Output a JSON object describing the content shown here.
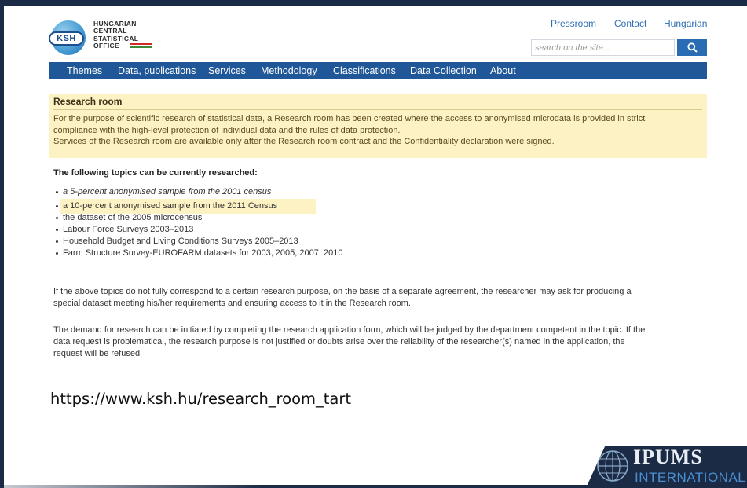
{
  "logo": {
    "abbr": "KSH",
    "line1": "HUNGARIAN",
    "line2": "CENTRAL",
    "line3": "STATISTICAL",
    "line4": "OFFICE"
  },
  "top_links": {
    "pressroom": "Pressroom",
    "contact": "Contact",
    "language": "Hungarian"
  },
  "search": {
    "placeholder": "search on the site..."
  },
  "nav": {
    "items": [
      "Themes",
      "Data, publications",
      "Services",
      "Methodology",
      "Classifications",
      "Data Collection",
      "About"
    ]
  },
  "research_room": {
    "title": "Research room",
    "line1": "For the purpose of scientific research of statistical data, a Research room has been created where the access to anonymised microdata is provided in strict",
    "line2": "compliance with the high-level protection of individual data and the rules of data protection.",
    "line3": "Services of the Research room are available only after the Research room contract and the Confidentiality declaration were signed."
  },
  "topics": {
    "heading": "The following topics can be currently researched:",
    "items": [
      "a 5-percent anonymised sample from the 2001 census",
      "a 10-percent anonymised sample from the 2011 Census",
      "the dataset of the 2005 microcensus",
      "Labour Force Surveys 2003–2013",
      "Household Budget and Living Conditions Surveys 2005–2013",
      "Farm Structure Survey-EUROFARM datasets for 2003, 2005, 2007, 2010"
    ]
  },
  "paragraphs": {
    "p1_line1": "If the above topics do not fully correspond to a certain research purpose, on the basis of a separate agreement, the researcher may ask for producing a",
    "p1_line2": "special dataset meeting his/her requirements and ensuring access to it in the Research room.",
    "p2_line1": "The demand for research can be initiated by completing the research application form, which will be judged by the department competent in the topic. If the",
    "p2_line2": "data request is problematical, the research purpose is not justified or doubts arise over the reliability of the researcher(s) named in the application, the",
    "p2_line3": "request will be refused."
  },
  "slide": {
    "url": "https://www.ksh.hu/research_room_tart",
    "brand_name": "IPUMS",
    "brand_sub": "INTERNATIONAL"
  },
  "colors": {
    "nav_bg": "#1f5798",
    "highlight": "#fdf2c4",
    "link": "#2d6db5",
    "slide_border": "#1b2a45"
  },
  "icons": {
    "search_button": "search-icon",
    "globe": "globe-icon"
  }
}
